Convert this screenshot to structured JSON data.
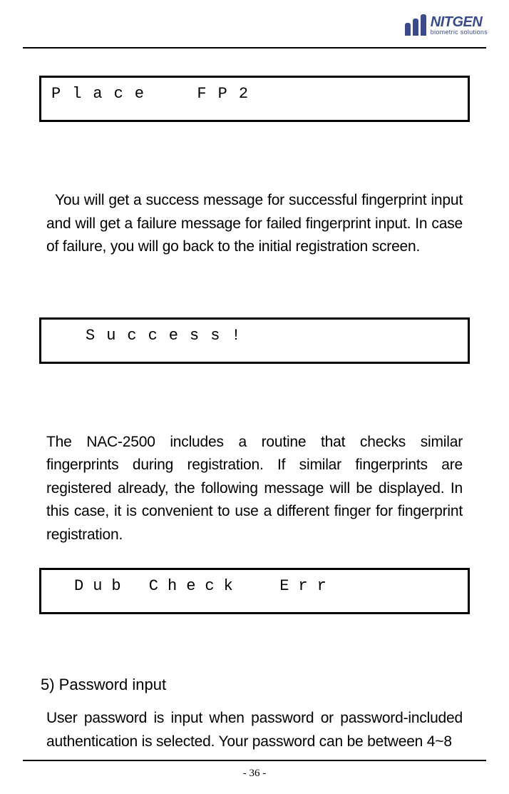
{
  "logo": {
    "name": "NITGEN",
    "tagline": "biometric solutions"
  },
  "lcd": {
    "box1": "Place  FP2",
    "box2": "Success!",
    "box3": "Dub Check  Err"
  },
  "paragraphs": {
    "p1": "You will get a success message for successful fingerprint input and will get a failure message for failed fingerprint input. In case of failure, you will go back to the initial registration screen.",
    "p2": "The NAC-2500 includes a routine that checks similar fingerprints during registration. If similar fingerprints are registered already, the following message will be displayed. In this case, it is convenient to use a different finger for fingerprint registration."
  },
  "heading": "5) Password input",
  "paragraphs2": {
    "p3": "User password is input when password or password-included authentication is selected. Your password can be between 4~8"
  },
  "pageNumber": "- 36 -"
}
